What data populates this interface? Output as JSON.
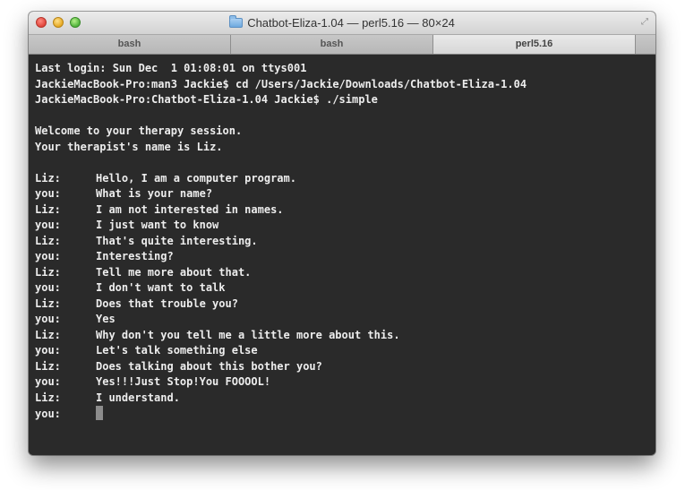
{
  "window": {
    "title": "Chatbot-Eliza-1.04 — perl5.16 — 80×24",
    "title_icon": "folder-icon",
    "fullscreen_icon": "fullscreen-icon"
  },
  "tabs": [
    {
      "label": "bash",
      "active": false
    },
    {
      "label": "bash",
      "active": false
    },
    {
      "label": "perl5.16",
      "active": true
    }
  ],
  "terminal": {
    "session_lines": [
      "Last login: Sun Dec  1 01:08:01 on ttys001",
      "JackieMacBook-Pro:man3 Jackie$ cd /Users/Jackie/Downloads/Chatbot-Eliza-1.04",
      "JackieMacBook-Pro:Chatbot-Eliza-1.04 Jackie$ ./simple"
    ],
    "welcome_lines": [
      "Welcome to your therapy session.",
      "Your therapist's name is Liz."
    ],
    "conversation": [
      {
        "speaker": "Liz:",
        "text": "Hello, I am a computer program."
      },
      {
        "speaker": "you:",
        "text": "What is your name?"
      },
      {
        "speaker": "Liz:",
        "text": "I am not interested in names."
      },
      {
        "speaker": "you:",
        "text": "I just want to know"
      },
      {
        "speaker": "Liz:",
        "text": "That's quite interesting."
      },
      {
        "speaker": "you:",
        "text": "Interesting?"
      },
      {
        "speaker": "Liz:",
        "text": "Tell me more about that."
      },
      {
        "speaker": "you:",
        "text": "I don't want to talk"
      },
      {
        "speaker": "Liz:",
        "text": "Does that trouble you?"
      },
      {
        "speaker": "you:",
        "text": "Yes"
      },
      {
        "speaker": "Liz:",
        "text": "Why don't you tell me a little more about this."
      },
      {
        "speaker": "you:",
        "text": "Let's talk something else"
      },
      {
        "speaker": "Liz:",
        "text": "Does talking about this bother you?"
      },
      {
        "speaker": "you:",
        "text": "Yes!!!Just Stop!You FOOOOL!"
      },
      {
        "speaker": "Liz:",
        "text": "I understand."
      }
    ],
    "prompt": {
      "speaker": "you:",
      "text": ""
    }
  }
}
